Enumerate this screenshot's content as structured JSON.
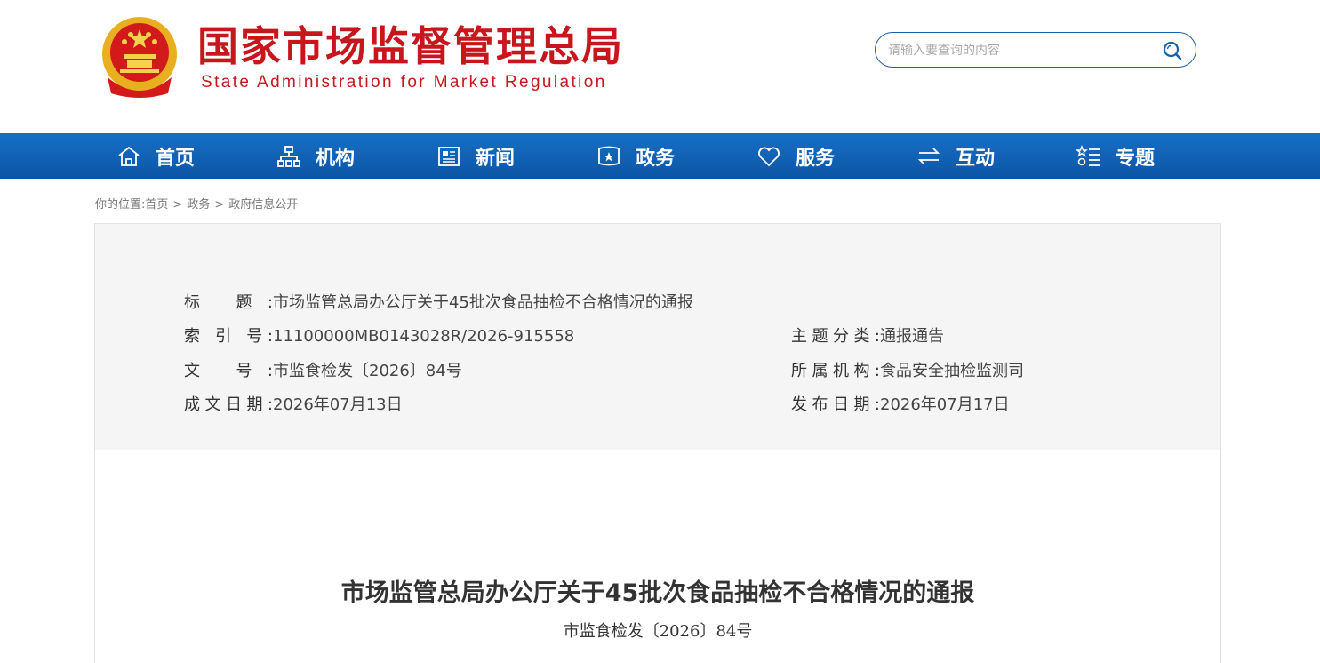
{
  "header": {
    "title": "国家市场监督管理总局",
    "subtitle": "State Administration for Market Regulation",
    "search_placeholder": "请输入要查询的内容"
  },
  "nav": {
    "items": [
      {
        "label": "首页",
        "icon": "home-icon"
      },
      {
        "label": "机构",
        "icon": "org-chart-icon"
      },
      {
        "label": "新闻",
        "icon": "newspaper-icon"
      },
      {
        "label": "政务",
        "icon": "badge-icon"
      },
      {
        "label": "服务",
        "icon": "heart-icon"
      },
      {
        "label": "互动",
        "icon": "exchange-icon"
      },
      {
        "label": "专题",
        "icon": "list-icon"
      }
    ]
  },
  "breadcrumb": {
    "prefix": "你的位置:",
    "items": [
      "首页",
      "政务",
      "政府信息公开"
    ],
    "separator": ">"
  },
  "meta": {
    "title_label": "标 题:",
    "title_value": "市场监管总局办公厅关于45批次食品抽检不合格情况的通报",
    "index_label": "索 引 号:",
    "index_value": "11100000MB0143028R/2026-915558",
    "topic_label": "主题分类:",
    "topic_value": "通报通告",
    "docno_label": "文 号:",
    "docno_value": "市监食检发〔2026〕84号",
    "org_label": "所属机构:",
    "org_value": "食品安全抽检监测司",
    "created_label": "成文日期:",
    "created_value": "2026年07月13日",
    "published_label": "发布日期:",
    "published_value": "2026年07月17日"
  },
  "document": {
    "title": "市场监管总局办公厅关于45批次食品抽检不合格情况的通报",
    "number": "市监食检发〔2026〕84号"
  },
  "colors": {
    "brand_red": "#c8161d",
    "nav_blue": "#0d54a4",
    "panel_bg": "#f5f5f5"
  }
}
